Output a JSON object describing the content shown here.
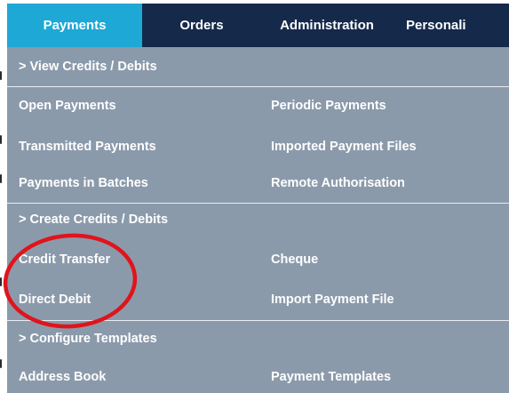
{
  "topnav": {
    "tabs": [
      {
        "label": "Payments"
      },
      {
        "label": "Orders"
      },
      {
        "label": "Administration"
      },
      {
        "label": "Personali"
      }
    ]
  },
  "menu": {
    "sections": [
      {
        "header": "> View Credits / Debits",
        "rows": [
          {
            "left": "Open Payments",
            "right": "Periodic Payments"
          },
          {
            "left": "Transmitted Payments",
            "right": "Imported Payment Files"
          },
          {
            "left": "Payments in Batches",
            "right": "Remote Authorisation"
          }
        ]
      },
      {
        "header": "> Create Credits / Debits",
        "rows": [
          {
            "left": "Credit Transfer",
            "right": "Cheque"
          },
          {
            "left": "Direct Debit",
            "right": "Import Payment File"
          }
        ]
      },
      {
        "header": "> Configure Templates",
        "rows": [
          {
            "left": "Address Book",
            "right": "Payment Templates"
          }
        ]
      }
    ]
  },
  "colors": {
    "nav_background": "#15294b",
    "active_tab": "#1ea8d6",
    "menu_background": "#8b9aab",
    "annotation": "#e0141b"
  }
}
